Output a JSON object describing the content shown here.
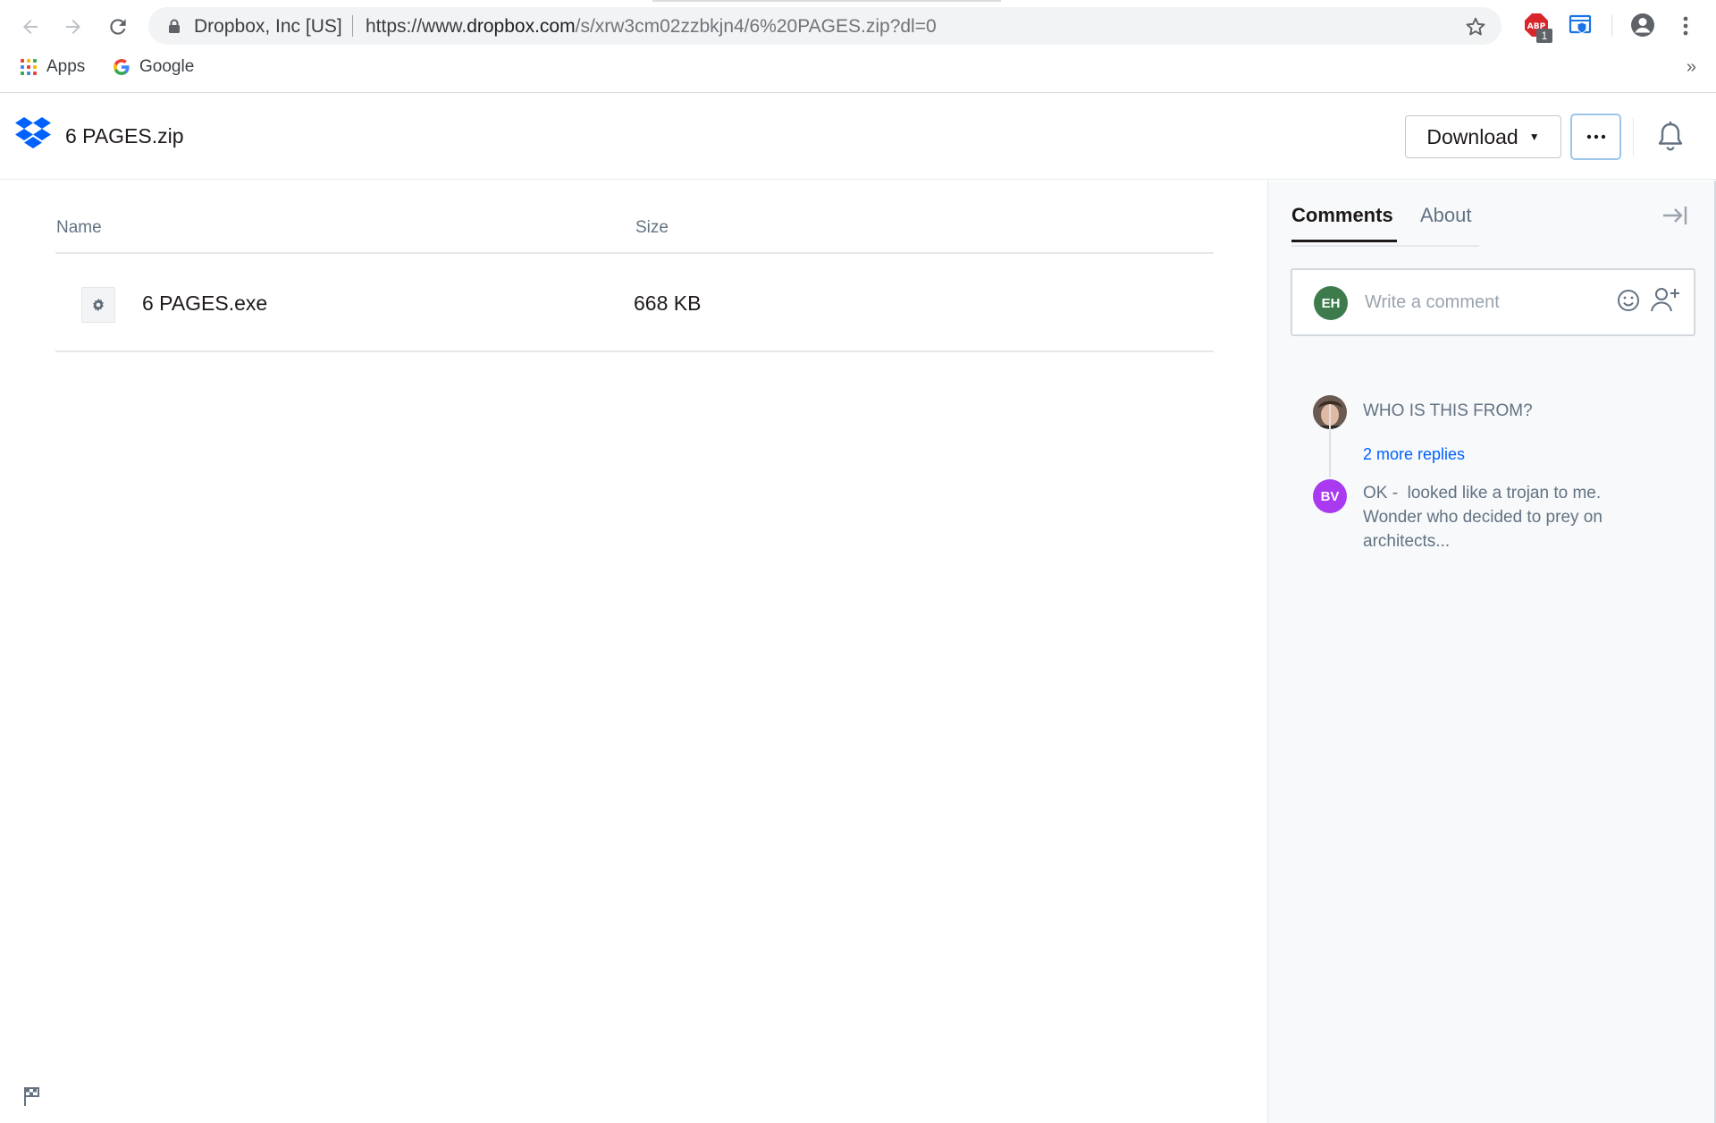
{
  "browser": {
    "site_identity": "Dropbox, Inc [US]",
    "url_scheme": "https://www.",
    "url_host": "dropbox.com",
    "url_path": "/s/xrw3cm02zzbkjn4/6%20PAGES.zip?dl=0",
    "extension_badge_count": "1",
    "bookmarks": [
      {
        "label": "Apps"
      },
      {
        "label": "Google"
      }
    ],
    "bookmarks_overflow": "»"
  },
  "header": {
    "file_title": "6 PAGES.zip",
    "download_label": "Download",
    "download_caret": "▼",
    "more_label": "···"
  },
  "file_list": {
    "columns": {
      "name": "Name",
      "size": "Size"
    },
    "rows": [
      {
        "name": "6 PAGES.exe",
        "size": "668 KB",
        "icon": "gear-icon"
      }
    ]
  },
  "sidebar": {
    "tabs": [
      {
        "label": "Comments",
        "active": true
      },
      {
        "label": "About",
        "active": false
      }
    ],
    "comment_input": {
      "avatar_initials": "EH",
      "placeholder": "Write a comment"
    },
    "thread": {
      "first_comment": "WHO IS THIS FROM?",
      "more_replies": "2 more replies",
      "reply_avatar_initials": "BV",
      "reply_text_line1": "OK -  looked like a trojan to me.",
      "reply_text_line2": "Wonder who decided to prey on",
      "reply_text_line3": "architects..."
    }
  },
  "colors": {
    "dropbox_blue": "#0061fe",
    "avatar_eh": "#3d7a4c",
    "avatar_bv": "#a93af0",
    "link_blue": "#0061fe"
  }
}
